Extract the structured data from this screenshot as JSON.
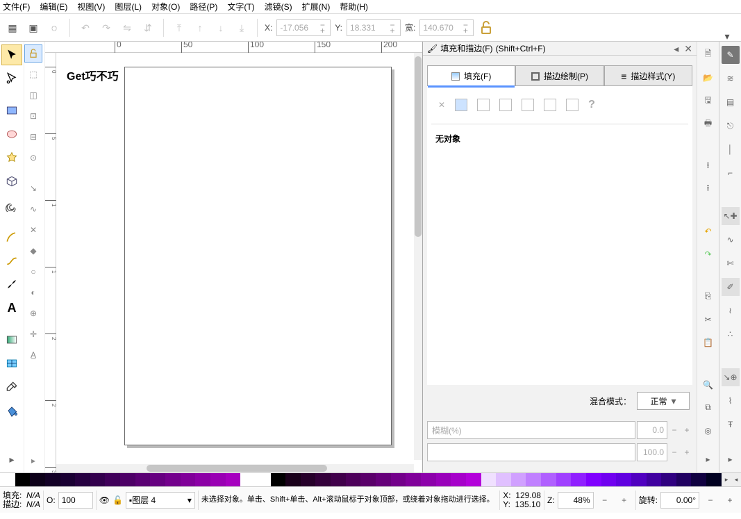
{
  "menu": [
    "文件(F)",
    "编辑(E)",
    "视图(V)",
    "图层(L)",
    "对象(O)",
    "路径(P)",
    "文字(T)",
    "滤镜(S)",
    "扩展(N)",
    "帮助(H)"
  ],
  "opt": {
    "x_label": "X:",
    "x_value": "-17.056",
    "y_label": "Y:",
    "y_value": "18.331",
    "w_label": "宽:",
    "w_value": "140.670"
  },
  "canvas_text": "Get巧不巧",
  "ruler_h": [
    "0",
    "50",
    "100",
    "150",
    "200"
  ],
  "ruler_v": [
    "0",
    "5",
    "1",
    "1",
    "2",
    "2",
    "3"
  ],
  "panel": {
    "title": "填充和描边(F)",
    "shortcut": "(Shift+Ctrl+F)",
    "tabs": [
      "填充(F)",
      "描边绘制(P)",
      "描边样式(Y)"
    ],
    "noobj": "无对象",
    "blend_label": "混合模式：",
    "blend_value": "正常",
    "blur_label": "模糊(%)",
    "blur_val": "0.0",
    "op_val": "100.0"
  },
  "status": {
    "fill_label": "填充:",
    "fill_val": "N/A",
    "stroke_label": "描边:",
    "stroke_val": "N/A",
    "opacity_label": "O:",
    "opacity_val": "100",
    "layer": "▪图层 4",
    "layer_arrow": "▾",
    "msg": "未选择对象。单击、Shift+单击、Alt+滚动鼠标于对象顶部，或绕着对象拖动进行选择。",
    "x_label": "X:",
    "x_val": "129.08",
    "y_label": "Y:",
    "y_val": "135.10",
    "z_label": "Z:",
    "zoom": "48%",
    "rot_label": "旋转:",
    "rot_val": "0.00°"
  },
  "palette_colors": [
    "#ffffff",
    "#000000",
    "#0d0019",
    "#130026",
    "#1a0033",
    "#260040",
    "#33004d",
    "#40005a",
    "#4d0066",
    "#5a0073",
    "#660080",
    "#73008c",
    "#800099",
    "#8c00a6",
    "#9900b3",
    "#a600bf",
    "#ffffff",
    "#ffffff",
    "#000000",
    "#19001a",
    "#26002a",
    "#33003a",
    "#40004a",
    "#4d005a",
    "#5a006a",
    "#66007a",
    "#73008a",
    "#80009a",
    "#8c00aa",
    "#9900ba",
    "#a600ca",
    "#b300da",
    "#f0e0ff",
    "#e0c0ff",
    "#d0a0ff",
    "#c080ff",
    "#b060ff",
    "#a040ff",
    "#9020ff",
    "#8000ff",
    "#7000f0",
    "#6000e0",
    "#5000c0",
    "#4000a0",
    "#300080",
    "#200060",
    "#100040",
    "#000020"
  ],
  "palette_arrow": "◂"
}
